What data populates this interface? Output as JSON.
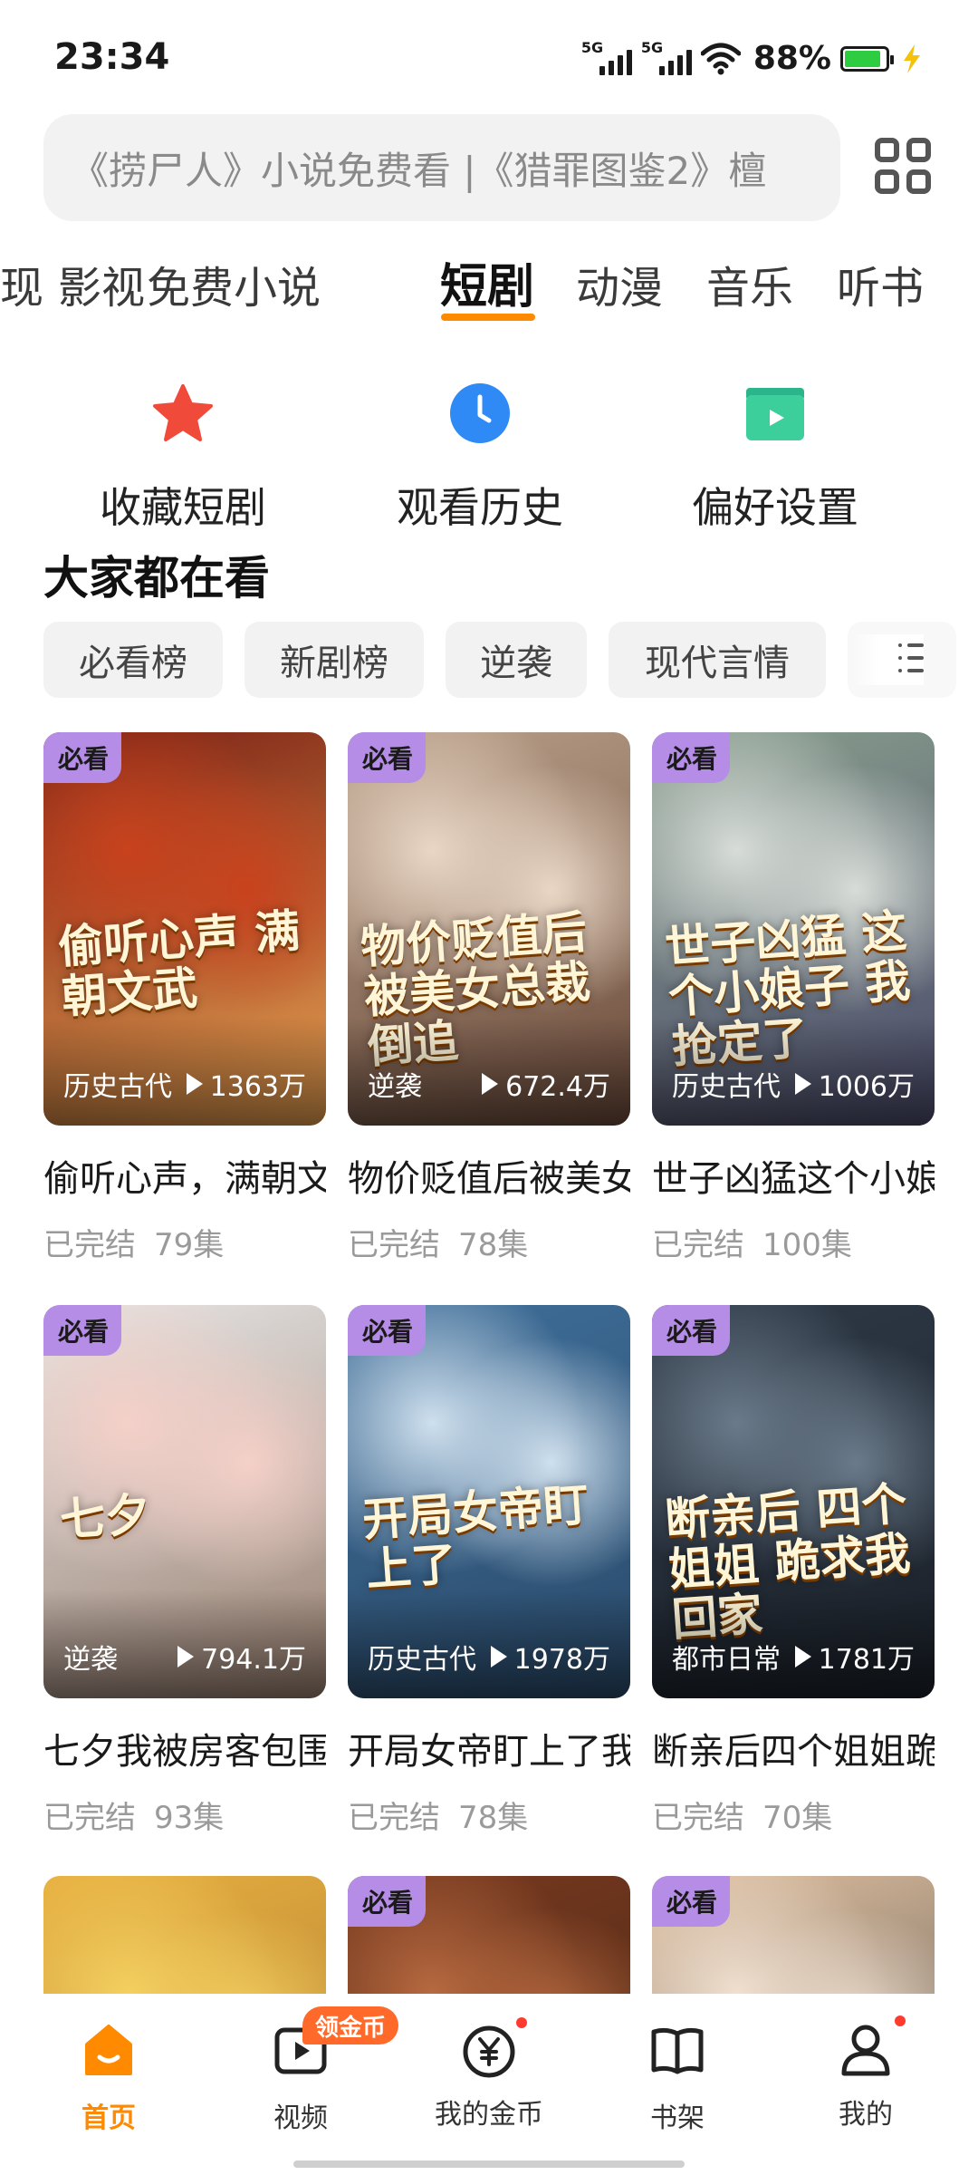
{
  "status_bar": {
    "time": "23:34",
    "network_1": "5G",
    "network_2": "5G",
    "battery_percent": "88%",
    "battery_level": 0.88
  },
  "search": {
    "placeholder": "《捞尸人》小说免费看 |《猎罪图鉴2》檀"
  },
  "tabs": [
    "现",
    "影视",
    "免费小说",
    "短剧",
    "动漫",
    "音乐",
    "听书"
  ],
  "active_tab": "短剧",
  "quick_actions": [
    {
      "label": "收藏短剧",
      "icon": "star-icon"
    },
    {
      "label": "观看历史",
      "icon": "clock-icon"
    },
    {
      "label": "偏好设置",
      "icon": "video-folder-icon"
    }
  ],
  "section": {
    "title": "大家都在看",
    "filters": [
      "必看榜",
      "新剧榜",
      "逆袭",
      "现代言情"
    ]
  },
  "cards": [
    {
      "badge": "必看",
      "genre": "历史古代",
      "views": "1363万",
      "title": "偷听心声，满朝文武",
      "status": "已完结",
      "episodes": "79集",
      "poster_title": "偷听心声 满朝文武",
      "colors": [
        "#7a1f14",
        "#c8421d",
        "#e8a050"
      ]
    },
    {
      "badge": "必看",
      "genre": "逆袭",
      "views": "672.4万",
      "title": "物价贬值后被美女总裁倒追",
      "status": "已完结",
      "episodes": "78集",
      "poster_title": "物价贬值后 被美女总裁倒追",
      "colors": [
        "#b9a08a",
        "#e9d7c6",
        "#6b4a3a"
      ]
    },
    {
      "badge": "必看",
      "genre": "历史古代",
      "views": "1006万",
      "title": "世子凶猛这个小娘子",
      "status": "已完结",
      "episodes": "100集",
      "poster_title": "世子凶猛 这个小娘子 我抢定了",
      "colors": [
        "#8aa08e",
        "#d7dcd7",
        "#4a4a6a"
      ]
    },
    {
      "badge": "必看",
      "genre": "逆袭",
      "views": "794.1万",
      "title": "七夕我被房客包围了",
      "status": "已完结",
      "episodes": "93集",
      "poster_title": "七夕",
      "colors": [
        "#e6e6e6",
        "#f4d0c8",
        "#9a8070"
      ]
    },
    {
      "badge": "必看",
      "genre": "历史古代",
      "views": "1978万",
      "title": "开局女帝盯上了我",
      "status": "已完结",
      "episodes": "78集",
      "poster_title": "开局女帝盯上了",
      "colors": [
        "#3f6f9a",
        "#cfe0ee",
        "#2a4a6a"
      ]
    },
    {
      "badge": "必看",
      "genre": "都市日常",
      "views": "1781万",
      "title": "断亲后四个姐姐跪求我回家",
      "status": "已完结",
      "episodes": "70集",
      "poster_title": "断亲后 四个姐姐 跪求我回家",
      "colors": [
        "#2f3a48",
        "#6a7a8a",
        "#1a2028"
      ]
    },
    {
      "badge": "",
      "colors": [
        "#e8b040",
        "#f4d060",
        "#a07030"
      ]
    },
    {
      "badge": "必看",
      "colors": [
        "#7a3a20",
        "#b86a40",
        "#3a2010"
      ]
    },
    {
      "badge": "必看",
      "colors": [
        "#e0c0a0",
        "#f0e0d0",
        "#404040"
      ]
    }
  ],
  "bottom_nav": [
    {
      "label": "首页",
      "icon": "home-icon",
      "active": true
    },
    {
      "label": "视频",
      "icon": "video-icon",
      "active": false,
      "pill": "领金币"
    },
    {
      "label": "我的金币",
      "icon": "coin-icon",
      "active": false,
      "dot": true
    },
    {
      "label": "书架",
      "icon": "bookshelf-icon",
      "active": false
    },
    {
      "label": "我的",
      "icon": "profile-icon",
      "active": false,
      "dot": true
    }
  ],
  "colors": {
    "accent": "#ff8a00",
    "badge": "#b58ce6",
    "chip_bg": "#f2f2f2",
    "muted_text": "#9a9a9a"
  }
}
